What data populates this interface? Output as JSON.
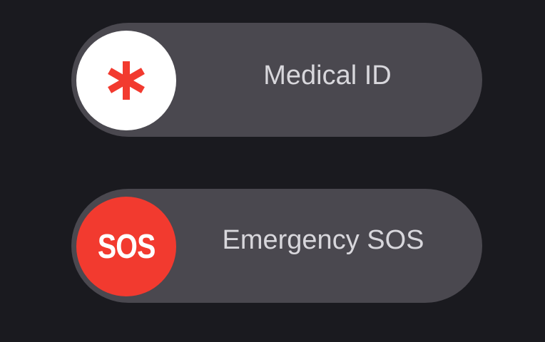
{
  "sliders": {
    "medical": {
      "label": "Medical ID",
      "icon": "asterisk-icon",
      "knob_color": "#ffffff",
      "icon_color": "#f23a2f"
    },
    "sos": {
      "label": "Emergency SOS",
      "knob_text": "SOS",
      "knob_color": "#f23a2f"
    }
  },
  "colors": {
    "background": "#1a1a1f",
    "track": "#4a484f",
    "label": "#d8d7dc"
  }
}
